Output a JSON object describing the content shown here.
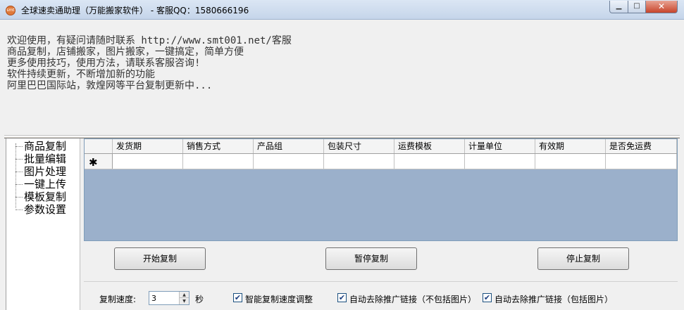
{
  "window": {
    "title": "全球速卖通助理（万能搬家软件） - 客服QQ：1580666196",
    "icon_label": "smt",
    "minimize_glyph": "▁",
    "maximize_glyph": "□",
    "close_glyph": "✕"
  },
  "info": {
    "lines": [
      "欢迎使用，有疑问请随时联系 http://www.smt001.net/客服",
      "商品复制，店铺搬家，图片搬家，一键搞定，简单方便",
      "更多使用技巧，使用方法，请联系客服咨询!",
      "软件持续更新，不断增加新的功能",
      "阿里巴巴国际站，敦煌网等平台复制更新中..."
    ]
  },
  "nav": {
    "items": [
      {
        "label": "商品复制"
      },
      {
        "label": "批量编辑"
      },
      {
        "label": "图片处理"
      },
      {
        "label": "一键上传"
      },
      {
        "label": "模板复制"
      },
      {
        "label": "参数设置"
      }
    ]
  },
  "grid": {
    "columns": [
      "发货期",
      "销售方式",
      "产品组",
      "包装尺寸",
      "运费模板",
      "计量单位",
      "有效期",
      "是否免运费"
    ],
    "new_row_marker": "✱"
  },
  "actions": {
    "start": "开始复制",
    "pause": "暂停复制",
    "stop": "停止复制"
  },
  "options": {
    "speed_label": "复制速度:",
    "speed_value": "3",
    "speed_unit": "秒",
    "smart_speed_label": "智能复制速度调整",
    "smart_speed_checked": true,
    "remove_links_no_img_label": "自动去除推广链接（不包括图片）",
    "remove_links_no_img_checked": true,
    "remove_links_img_label": "自动去除推广链接（包括图片）",
    "remove_links_img_checked": true,
    "check_glyph": "✔"
  }
}
